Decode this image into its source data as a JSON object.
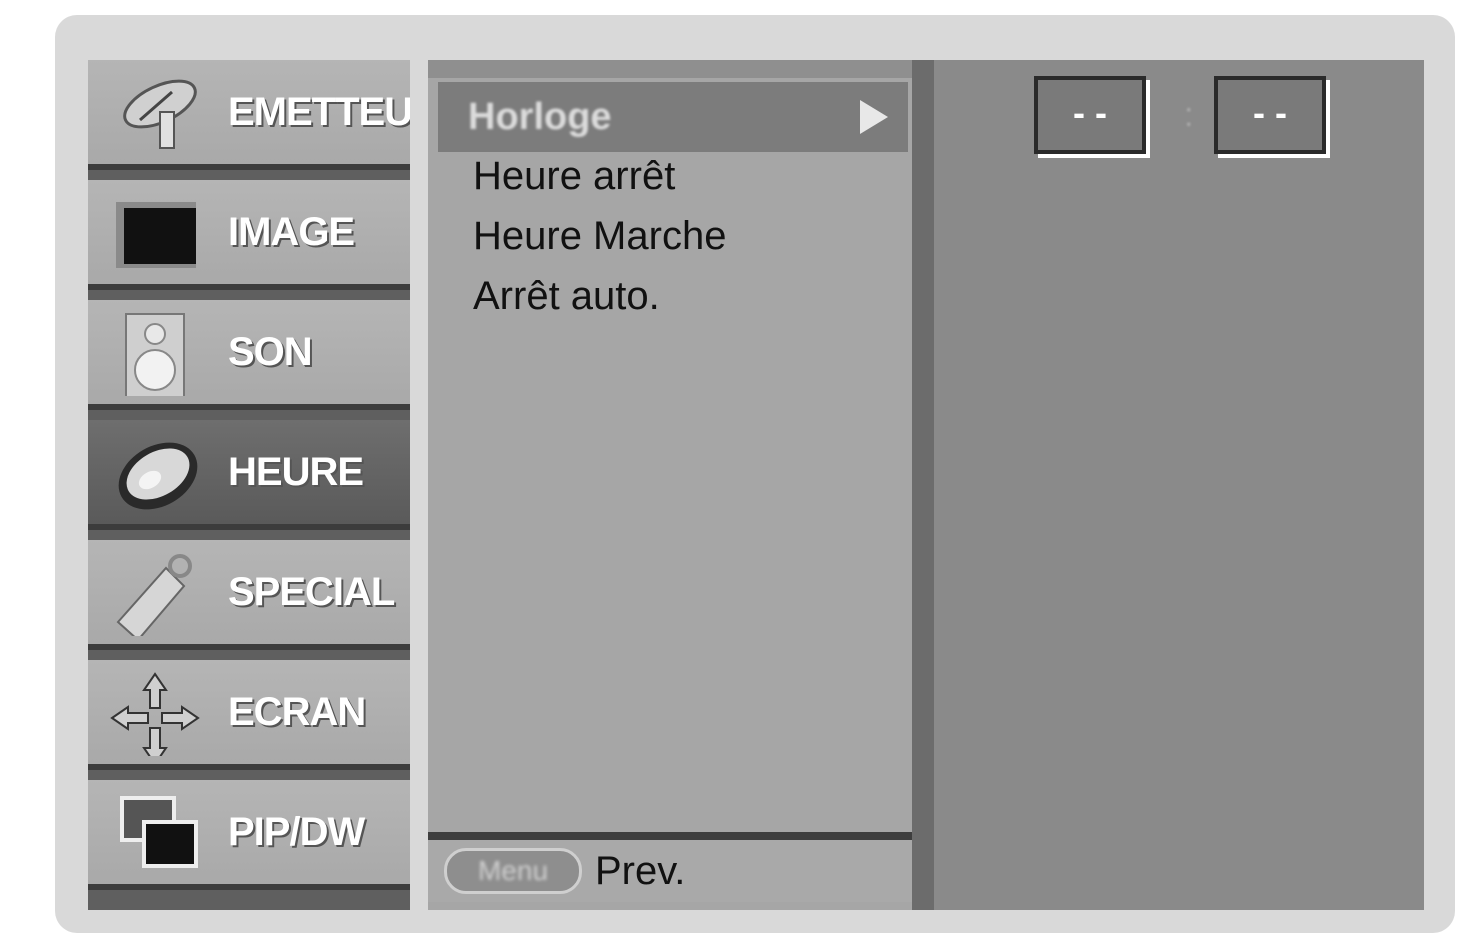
{
  "sidebar": {
    "items": [
      {
        "label": "EMETTEUR",
        "icon": "satellite-dish-icon"
      },
      {
        "label": "IMAGE",
        "icon": "picture-icon"
      },
      {
        "label": "SON",
        "icon": "speaker-icon"
      },
      {
        "label": "HEURE",
        "icon": "clock-icon",
        "active": true
      },
      {
        "label": "SPECIAL",
        "icon": "key-tag-icon"
      },
      {
        "label": "ECRAN",
        "icon": "move-arrows-icon"
      },
      {
        "label": "PIP/DW",
        "icon": "pip-windows-icon"
      }
    ]
  },
  "menu": {
    "selected": {
      "label": "Horloge"
    },
    "items": [
      "Heure arrêt",
      "Heure Marche",
      "Arrêt auto."
    ],
    "footer": {
      "button_label": "Menu",
      "action_label": "Prev."
    }
  },
  "panel": {
    "hours": "- -",
    "separator": ":",
    "minutes": "- -"
  },
  "colors": {
    "frame": "#d9d9d9",
    "sidebar_item": "#b0b0b0",
    "sidebar_active": "#626262",
    "menu_bg": "#a6a6a6",
    "highlight": "#7c7c7c",
    "panel_bg": "#8a8a8a"
  }
}
